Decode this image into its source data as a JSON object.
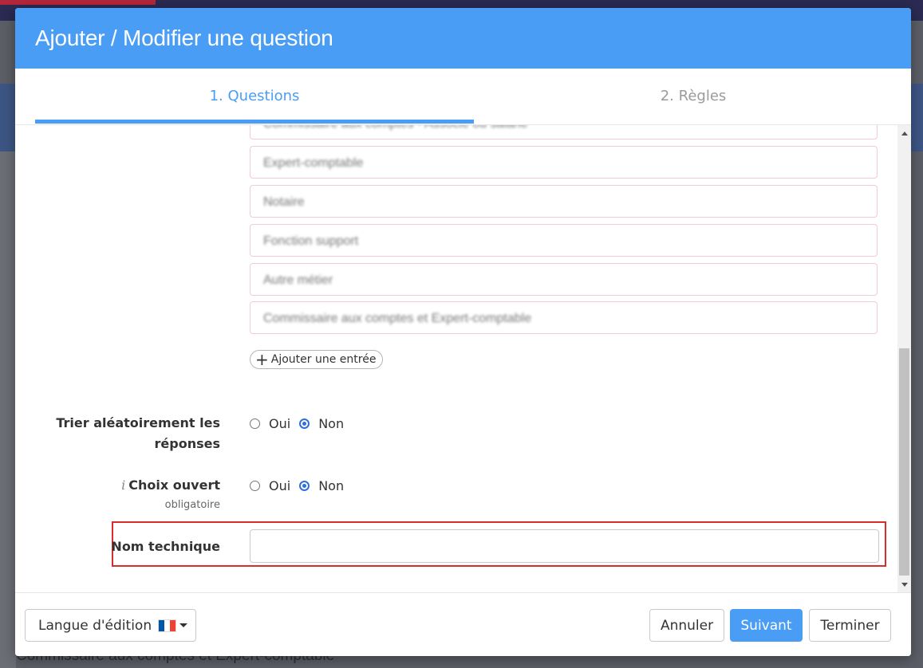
{
  "background": {
    "bottom_text": "Commissaire aux comptes et Expert-comptable"
  },
  "dialog": {
    "title": "Ajouter / Modifier une question",
    "tabs": [
      {
        "label": "1. Questions",
        "active": true
      },
      {
        "label": "2. Règles",
        "active": false
      }
    ],
    "entries": [
      "Commissaire aux comptes - Associé ou salarié",
      "Expert-comptable",
      "Notaire",
      "Fonction support",
      "Autre métier",
      "Commissaire aux comptes et Expert-comptable"
    ],
    "add_entry_label": "Ajouter une entrée",
    "random_order": {
      "label_line1": "Trier aléatoirement les",
      "label_line2": "réponses",
      "options": [
        "Oui",
        "Non"
      ],
      "selected": "Non"
    },
    "open_choice": {
      "info_glyph": "i",
      "label": "Choix ouvert",
      "sublabel": "obligatoire",
      "options": [
        "Oui",
        "Non"
      ],
      "selected": "Non"
    },
    "technical_name": {
      "label": "Nom technique",
      "value": ""
    },
    "footer": {
      "language_label": "Langue d'édition",
      "cancel_label": "Annuler",
      "next_label": "Suivant",
      "finish_label": "Terminer"
    },
    "colors": {
      "primary": "#4a9df4",
      "highlight": "#d92c2c"
    }
  }
}
